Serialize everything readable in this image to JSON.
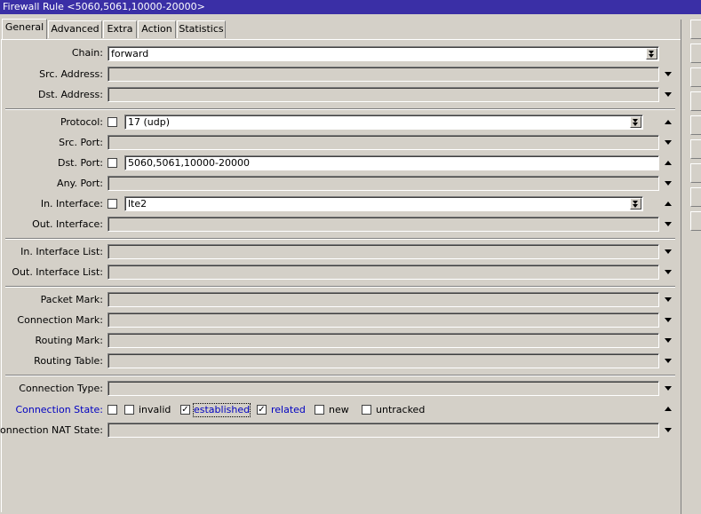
{
  "window": {
    "title": "Firewall Rule <5060,5061,10000-20000>"
  },
  "tabs": [
    {
      "label": "General"
    },
    {
      "label": "Advanced"
    },
    {
      "label": "Extra"
    },
    {
      "label": "Action"
    },
    {
      "label": "Statistics"
    }
  ],
  "general": {
    "chain": {
      "label": "Chain:",
      "value": "forward"
    },
    "src_address": {
      "label": "Src. Address:"
    },
    "dst_address": {
      "label": "Dst. Address:"
    },
    "protocol": {
      "label": "Protocol:",
      "value": "17 (udp)"
    },
    "src_port": {
      "label": "Src. Port:"
    },
    "dst_port": {
      "label": "Dst. Port:",
      "value": "5060,5061,10000-20000"
    },
    "any_port": {
      "label": "Any. Port:"
    },
    "in_interface": {
      "label": "In. Interface:",
      "value": "lte2"
    },
    "out_interface": {
      "label": "Out. Interface:"
    },
    "in_interface_list": {
      "label": "In. Interface List:"
    },
    "out_interface_list": {
      "label": "Out. Interface List:"
    },
    "packet_mark": {
      "label": "Packet Mark:"
    },
    "connection_mark": {
      "label": "Connection Mark:"
    },
    "routing_mark": {
      "label": "Routing Mark:"
    },
    "routing_table": {
      "label": "Routing Table:"
    },
    "connection_type": {
      "label": "Connection Type:"
    },
    "connection_state": {
      "label": "Connection State:",
      "options": [
        {
          "label": "invalid",
          "checked": false
        },
        {
          "label": "established",
          "checked": true
        },
        {
          "label": "related",
          "checked": true
        },
        {
          "label": "new",
          "checked": false
        },
        {
          "label": "untracked",
          "checked": false
        }
      ]
    },
    "connection_nat_state": {
      "label": "Connection NAT State:"
    }
  }
}
